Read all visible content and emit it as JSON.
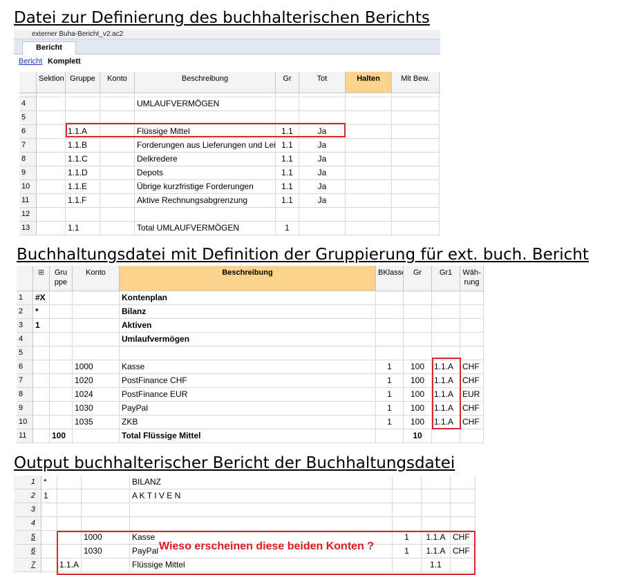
{
  "headings": {
    "h1": "Datei zur Definierung des buchhalterischen Berichts",
    "h2": "Buchhaltungsdatei mit Definition der Gruppierung für ext. buch. Bericht",
    "h3": "Output buchhalterischer Bericht der Buchhaltungsdatei"
  },
  "report_def": {
    "window_title": "externer Buha-Bericht_v2.ac2",
    "tab": "Bericht",
    "link": "Bericht",
    "view": "Komplett",
    "columns": [
      "Sektion",
      "Gruppe",
      "Konto",
      "Beschreibung",
      "Gr",
      "Tot",
      "Halten",
      "Mit Bew."
    ],
    "rows": [
      {
        "n": "4",
        "sektion": "",
        "gruppe": "",
        "konto": "",
        "beschreibung": "UMLAUFVERMÖGEN",
        "gr": "",
        "tot": ""
      },
      {
        "n": "5",
        "sektion": "",
        "gruppe": "",
        "konto": "",
        "beschreibung": "",
        "gr": "",
        "tot": ""
      },
      {
        "n": "6",
        "sektion": "",
        "gruppe": "1.1.A",
        "konto": "",
        "beschreibung": "Flüssige Mittel",
        "gr": "1.1",
        "tot": "Ja"
      },
      {
        "n": "7",
        "sektion": "",
        "gruppe": "1.1.B",
        "konto": "",
        "beschreibung": "Forderungen aus Lieferungen und Leist",
        "gr": "1.1",
        "tot": "Ja"
      },
      {
        "n": "8",
        "sektion": "",
        "gruppe": "1.1.C",
        "konto": "",
        "beschreibung": "Delkredere",
        "gr": "1.1",
        "tot": "Ja"
      },
      {
        "n": "9",
        "sektion": "",
        "gruppe": "1.1.D",
        "konto": "",
        "beschreibung": "Depots",
        "gr": "1.1",
        "tot": "Ja"
      },
      {
        "n": "10",
        "sektion": "",
        "gruppe": "1.1.E",
        "konto": "",
        "beschreibung": "Übrige kurzfristige Forderungen",
        "gr": "1.1",
        "tot": "Ja"
      },
      {
        "n": "11",
        "sektion": "",
        "gruppe": "1.1.F",
        "konto": "",
        "beschreibung": "Aktive Rechnungsabgrenzung",
        "gr": "1.1",
        "tot": "Ja"
      },
      {
        "n": "12",
        "sektion": "",
        "gruppe": "",
        "konto": "",
        "beschreibung": "",
        "gr": "",
        "tot": ""
      },
      {
        "n": "13",
        "sektion": "",
        "gruppe": "1.1",
        "konto": "",
        "beschreibung": "Total UMLAUFVERMÖGEN",
        "gr": "1",
        "tot": ""
      }
    ],
    "highlight_color": "#fbd38a"
  },
  "accounts": {
    "columns": [
      "Gru ppe",
      "Konto",
      "Beschreibung",
      "BKlasse",
      "Gr",
      "Gr1",
      "Wäh- rung"
    ],
    "rows": [
      {
        "n": "1",
        "sec": "#X",
        "gruppe": "",
        "konto": "",
        "beschreibung": "Kontenplan",
        "bk": "",
        "gr": "",
        "gr1": "",
        "w": "",
        "bold": true
      },
      {
        "n": "2",
        "sec": "*",
        "gruppe": "",
        "konto": "",
        "beschreibung": "Bilanz",
        "bk": "",
        "gr": "",
        "gr1": "",
        "w": "",
        "bold": true
      },
      {
        "n": "3",
        "sec": "1",
        "gruppe": "",
        "konto": "",
        "beschreibung": "Aktiven",
        "bk": "",
        "gr": "",
        "gr1": "",
        "w": "",
        "bold": true
      },
      {
        "n": "4",
        "sec": "",
        "gruppe": "",
        "konto": "",
        "beschreibung": "Umlaufvermögen",
        "bk": "",
        "gr": "",
        "gr1": "",
        "w": "",
        "bold": true
      },
      {
        "n": "5",
        "sec": "",
        "gruppe": "",
        "konto": "",
        "beschreibung": "",
        "bk": "",
        "gr": "",
        "gr1": "",
        "w": "",
        "bold": false
      },
      {
        "n": "6",
        "sec": "",
        "gruppe": "",
        "konto": "1000",
        "beschreibung": "Kasse",
        "bk": "1",
        "gr": "100",
        "gr1": "1.1.A",
        "w": "CHF",
        "bold": false
      },
      {
        "n": "7",
        "sec": "",
        "gruppe": "",
        "konto": "1020",
        "beschreibung": "PostFinance CHF",
        "bk": "1",
        "gr": "100",
        "gr1": "1.1.A",
        "w": "CHF",
        "bold": false
      },
      {
        "n": "8",
        "sec": "",
        "gruppe": "",
        "konto": "1024",
        "beschreibung": "PostFinance EUR",
        "bk": "1",
        "gr": "100",
        "gr1": "1.1.A",
        "w": "EUR",
        "bold": false
      },
      {
        "n": "9",
        "sec": "",
        "gruppe": "",
        "konto": "1030",
        "beschreibung": "PayPal",
        "bk": "1",
        "gr": "100",
        "gr1": "1.1.A",
        "w": "CHF",
        "bold": false
      },
      {
        "n": "10",
        "sec": "",
        "gruppe": "",
        "konto": "1035",
        "beschreibung": "ZKB",
        "bk": "1",
        "gr": "100",
        "gr1": "1.1.A",
        "w": "CHF",
        "bold": false
      },
      {
        "n": "11",
        "sec": "",
        "gruppe": "100",
        "konto": "",
        "beschreibung": "Total Flüssige Mittel",
        "bk": "",
        "gr": "10",
        "gr1": "",
        "w": "",
        "bold": true
      }
    ],
    "highlight_color": "#fbd38a"
  },
  "output": {
    "rows": [
      {
        "n": "1",
        "a": "*",
        "b": "",
        "c": "",
        "d": "BILANZ",
        "e": "",
        "f": "",
        "g": ""
      },
      {
        "n": "2",
        "a": "1",
        "b": "",
        "c": "",
        "d": "A K T I V E N",
        "e": "",
        "f": "",
        "g": ""
      },
      {
        "n": "3",
        "a": "",
        "b": "",
        "c": "",
        "d": "",
        "e": "",
        "f": "",
        "g": ""
      },
      {
        "n": "4",
        "a": "",
        "b": "",
        "c": "",
        "d": "",
        "e": "",
        "f": "",
        "g": ""
      },
      {
        "n": "5",
        "a": "",
        "b": "",
        "c": "1000",
        "d": "Kasse",
        "e": "1",
        "f": "1.1.A",
        "g": "CHF"
      },
      {
        "n": "6",
        "a": "",
        "b": "",
        "c": "1030",
        "d": "PayPal",
        "e": "1",
        "f": "1.1.A",
        "g": "CHF"
      },
      {
        "n": "7",
        "a": "",
        "b": "1.1.A",
        "c": "",
        "d": "Flüssige Mittel",
        "e": "",
        "f": "1.1",
        "g": ""
      }
    ],
    "annotation": "Wieso erscheinen diese beiden Konten ?",
    "annotation_color": "#e0191f"
  }
}
